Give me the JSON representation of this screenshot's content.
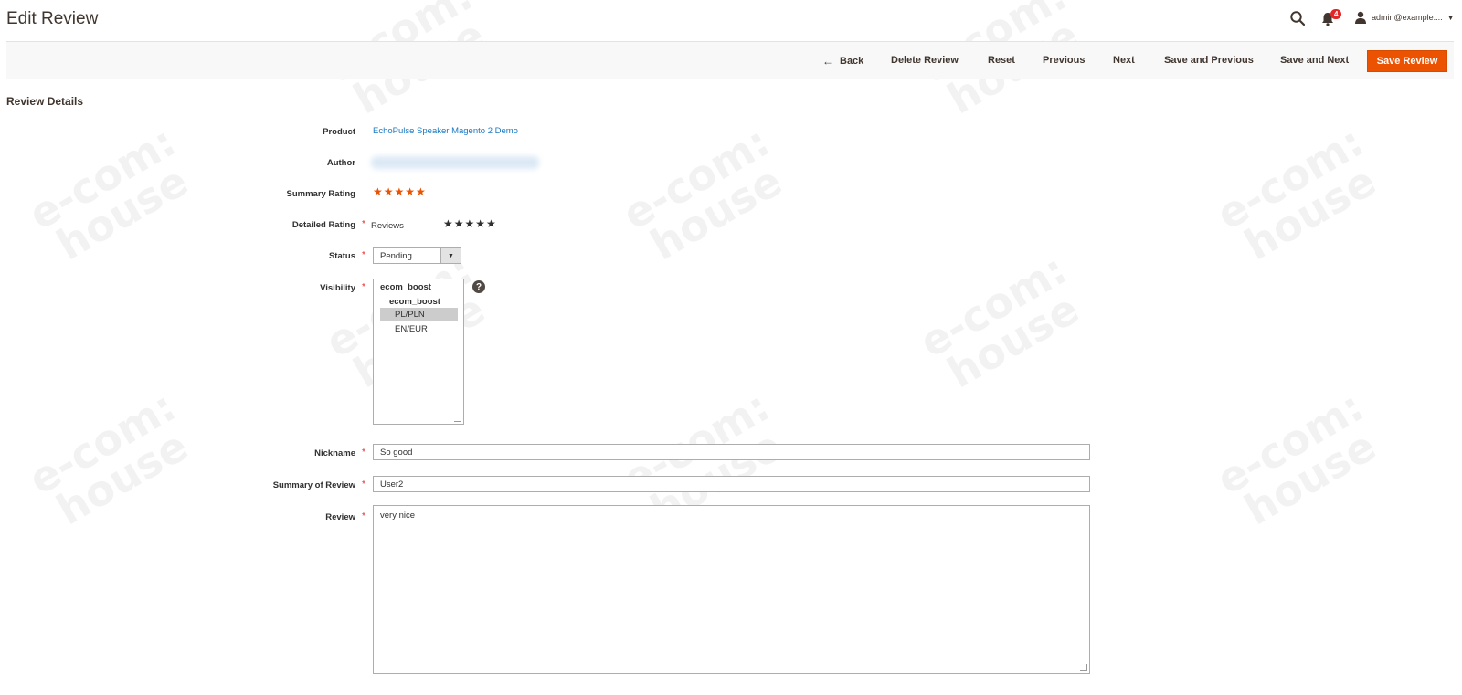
{
  "header": {
    "title": "Edit Review",
    "notification_count": "4",
    "user": "admin@example....",
    "icons": [
      "search-icon",
      "bell-icon",
      "user-icon"
    ]
  },
  "actions": {
    "back": "Back",
    "delete": "Delete Review",
    "reset": "Reset",
    "previous": "Previous",
    "next": "Next",
    "save_previous": "Save and Previous",
    "save_next": "Save and Next",
    "save": "Save Review"
  },
  "section_title": "Review Details",
  "form": {
    "product_label": "Product",
    "product_value": "EchoPulse Speaker Magento 2 Demo",
    "author_label": "Author",
    "summary_rating_label": "Summary Rating",
    "summary_rating_stars": "★★★★★",
    "detailed_rating_label": "Detailed Rating",
    "detailed_rating_name": "Reviews",
    "detailed_rating_stars": "★★★★★",
    "status_label": "Status",
    "status_value": "Pending",
    "visibility_label": "Visibility",
    "visibility_group": "ecom_boost",
    "visibility_subgroup": "ecom_boost",
    "visibility_options": [
      "PL/PLN",
      "EN/EUR"
    ],
    "visibility_selected": "PL/PLN",
    "nickname_label": "Nickname",
    "nickname_value": "So good",
    "summary_label": "Summary of Review",
    "summary_value": "User2",
    "review_label": "Review",
    "review_value": "very nice"
  },
  "required_marker": "*",
  "help_glyph": "?",
  "watermark": "e-com: house",
  "colors": {
    "accent": "#eb5202",
    "link": "#1979c3",
    "required": "#e22626"
  }
}
